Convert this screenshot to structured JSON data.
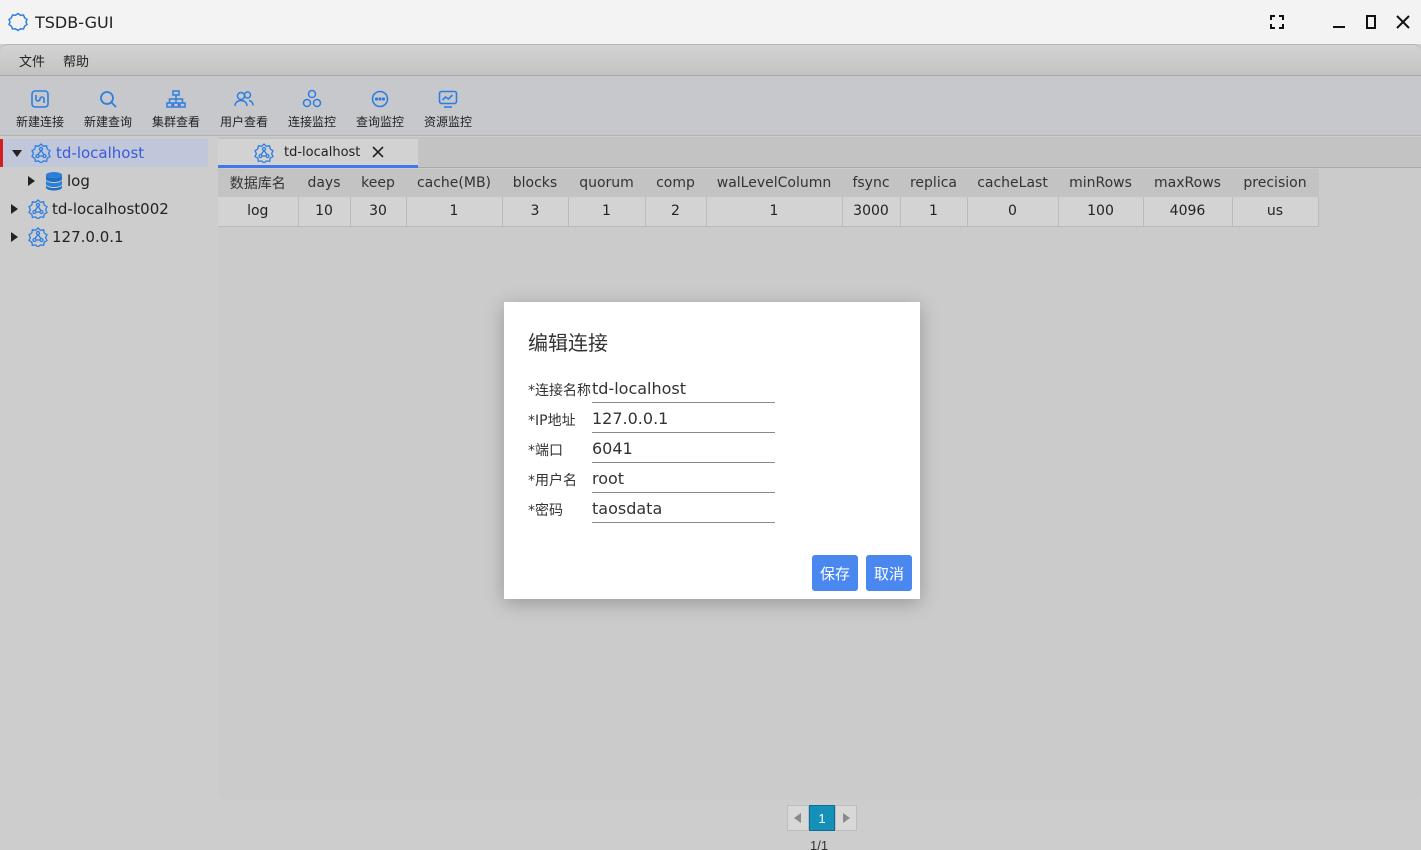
{
  "app": {
    "title": "TSDB-GUI"
  },
  "menu": {
    "items": [
      "文件",
      "帮助"
    ]
  },
  "toolbar": {
    "items": [
      {
        "label": "新建连接",
        "icon": "new-connection-icon"
      },
      {
        "label": "新建查询",
        "icon": "search-icon"
      },
      {
        "label": "集群查看",
        "icon": "cluster-icon"
      },
      {
        "label": "用户查看",
        "icon": "users-icon"
      },
      {
        "label": "连接监控",
        "icon": "connection-monitor-icon"
      },
      {
        "label": "查询监控",
        "icon": "query-monitor-icon"
      },
      {
        "label": "资源监控",
        "icon": "resource-monitor-icon"
      }
    ]
  },
  "tree": {
    "nodes": [
      {
        "label": "td-localhost",
        "expanded": true,
        "selected": true,
        "icon": "server-node-icon"
      },
      {
        "label": "log",
        "icon": "database-icon"
      },
      {
        "label": "td-localhost002",
        "icon": "server-node-icon"
      },
      {
        "label": "127.0.0.1",
        "icon": "server-node-icon"
      }
    ]
  },
  "tabs": [
    {
      "label": "td-localhost",
      "active": true
    }
  ],
  "table": {
    "columns": [
      "数据库名",
      "days",
      "keep",
      "cache(MB)",
      "blocks",
      "quorum",
      "comp",
      "walLevelColumn",
      "fsync",
      "replica",
      "cacheLast",
      "minRows",
      "maxRows",
      "precision"
    ],
    "rows": [
      [
        "log",
        "10",
        "30",
        "1",
        "3",
        "1",
        "2",
        "1",
        "3000",
        "1",
        "0",
        "100",
        "4096",
        "us"
      ]
    ]
  },
  "pagination": {
    "current": "1",
    "info": "1/1"
  },
  "dialog": {
    "title": "编辑连接",
    "fields": [
      {
        "label": "*连接名称",
        "value": "td-localhost"
      },
      {
        "label": "*IP地址",
        "value": "127.0.0.1"
      },
      {
        "label": "*端口",
        "value": "6041"
      },
      {
        "label": "*用户名",
        "value": "root"
      },
      {
        "label": "*密码",
        "value": "taosdata"
      }
    ],
    "save_label": "保存",
    "cancel_label": "取消"
  },
  "colors": {
    "accent": "#4a88f0",
    "selected_text": "#3a5bd9",
    "page_btn": "#1590b9",
    "icon_blue": "#2f7de1"
  }
}
